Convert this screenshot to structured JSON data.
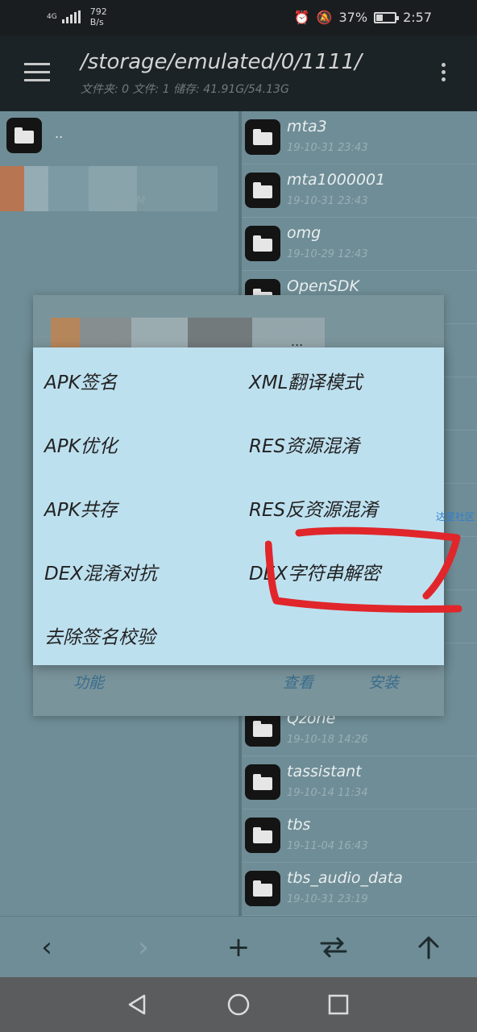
{
  "status_bar": {
    "network": "4G",
    "speed_value": "792",
    "speed_unit": "B/s",
    "battery": "37%",
    "battery_level": 0.37,
    "time": "2:57"
  },
  "app_bar": {
    "path": "/storage/emulated/0/1111/",
    "info": "文件夹: 0  文件: 1  储存: 41.91G/54.13G"
  },
  "left_pane": {
    "up_label": "..",
    "blurred_size": "19.6M"
  },
  "right_pane": {
    "folders": [
      {
        "name": "mta3",
        "date": "19-10-31 23:43"
      },
      {
        "name": "mta1000001",
        "date": "19-10-31 23:43"
      },
      {
        "name": "omg",
        "date": "19-10-29 12:43"
      },
      {
        "name": "OpenSDK",
        "date": ""
      },
      {
        "name": "",
        "date": ""
      },
      {
        "name": "",
        "date": ""
      },
      {
        "name": "",
        "date": ""
      },
      {
        "name": "",
        "date": ""
      },
      {
        "name": "",
        "date": ""
      },
      {
        "name": "",
        "date": ""
      },
      {
        "name": "Qzone",
        "date": "19-10-18 14:26"
      },
      {
        "name": "tassistant",
        "date": "19-10-14 11:34"
      },
      {
        "name": "tbs",
        "date": "19-11-04 16:43"
      },
      {
        "name": "tbs_audio_data",
        "date": "19-10-31 23:19"
      }
    ]
  },
  "bg_dialog": {
    "title_fragment": "...",
    "buttons": [
      "功能",
      "查看",
      "安装"
    ]
  },
  "menu": {
    "options": [
      "APK签名",
      "XML翻译模式",
      "APK优化",
      "RES资源混淆",
      "APK共存",
      "RES反资源混淆",
      "DEX混淆对抗",
      "DEX字符串解密",
      "去除签名校验"
    ],
    "highlighted": "DEX字符串解密"
  },
  "watermark": "达星社区",
  "colors": {
    "dialog_bg": "#bde0ef",
    "highlight_stroke": "#e0262b",
    "accent_link": "#3a6d8c"
  }
}
